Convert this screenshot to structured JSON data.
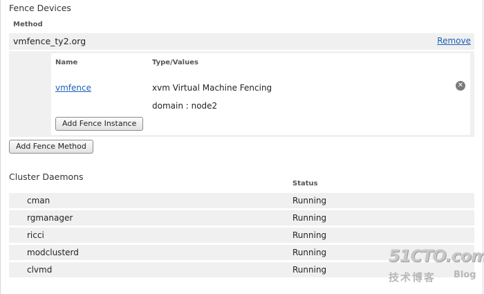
{
  "fence_devices": {
    "section_title": "Fence Devices",
    "method_header": "Method",
    "method": {
      "name": "vmfence_ty2.org",
      "remove_label": "Remove"
    },
    "instances": {
      "name_header": "Name",
      "type_header": "Type/Values",
      "items": [
        {
          "name": "vmfence",
          "type": "xvm Virtual Machine Fencing",
          "value": "domain : node2",
          "remove_icon": "close-circle-icon"
        }
      ],
      "add_instance_label": "Add Fence Instance"
    },
    "add_method_label": "Add Fence Method"
  },
  "cluster_daemons": {
    "section_title": "Cluster Daemons",
    "status_header": "Status",
    "rows": [
      {
        "name": "cman",
        "status": "Running"
      },
      {
        "name": "rgmanager",
        "status": "Running"
      },
      {
        "name": "ricci",
        "status": "Running"
      },
      {
        "name": "modclusterd",
        "status": "Running"
      },
      {
        "name": "clvmd",
        "status": "Running"
      }
    ]
  },
  "watermark": {
    "logo": "51CTO.com",
    "sub": "技术博客",
    "blog": "Blog"
  },
  "colors": {
    "link": "#1a5fb4",
    "row_background": "#f0f0f0"
  }
}
